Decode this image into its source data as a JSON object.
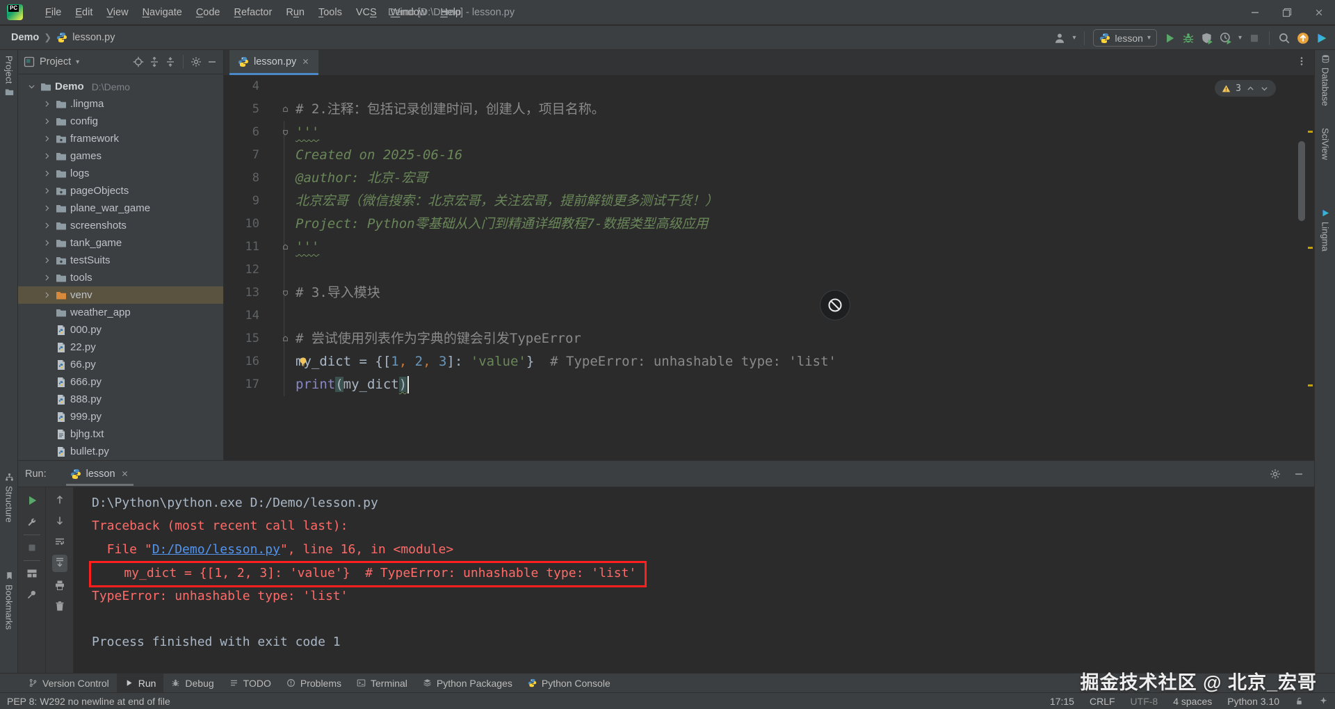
{
  "window": {
    "title": "Demo [D:\\Demo] - lesson.py"
  },
  "menu_items": [
    {
      "label": "File",
      "u": 0
    },
    {
      "label": "Edit",
      "u": 0
    },
    {
      "label": "View",
      "u": 0
    },
    {
      "label": "Navigate",
      "u": 0
    },
    {
      "label": "Code",
      "u": 0
    },
    {
      "label": "Refactor",
      "u": 0
    },
    {
      "label": "Run",
      "u": 1
    },
    {
      "label": "Tools",
      "u": 0
    },
    {
      "label": "VCS",
      "u": 2
    },
    {
      "label": "Window",
      "u": 0
    },
    {
      "label": "Help",
      "u": 0
    }
  ],
  "breadcrumbs": {
    "project": "Demo",
    "file": "lesson.py"
  },
  "navbar_right": {
    "run_config": "lesson"
  },
  "project_panel": {
    "title": "Project"
  },
  "project_tree": [
    {
      "label": "Demo",
      "path": "D:\\Demo",
      "icon": "folder",
      "chevron": "down",
      "bold": true,
      "root": true
    },
    {
      "label": ".lingma",
      "icon": "folder",
      "chevron": "right"
    },
    {
      "label": "config",
      "icon": "folder",
      "chevron": "right"
    },
    {
      "label": "framework",
      "icon": "folder-package",
      "chevron": "right"
    },
    {
      "label": "games",
      "icon": "folder",
      "chevron": "right"
    },
    {
      "label": "logs",
      "icon": "folder",
      "chevron": "right"
    },
    {
      "label": "pageObjects",
      "icon": "folder-package",
      "chevron": "right"
    },
    {
      "label": "plane_war_game",
      "icon": "folder",
      "chevron": "right"
    },
    {
      "label": "screenshots",
      "icon": "folder",
      "chevron": "right"
    },
    {
      "label": "tank_game",
      "icon": "folder",
      "chevron": "right"
    },
    {
      "label": "testSuits",
      "icon": "folder-package",
      "chevron": "right"
    },
    {
      "label": "tools",
      "icon": "folder",
      "chevron": "right"
    },
    {
      "label": "venv",
      "icon": "folder-excluded",
      "chevron": "right",
      "selected": true
    },
    {
      "label": "weather_app",
      "icon": "folder",
      "chevron": "none"
    },
    {
      "label": "000.py",
      "icon": "file-python",
      "chevron": "none"
    },
    {
      "label": "22.py",
      "icon": "file-python",
      "chevron": "none"
    },
    {
      "label": "66.py",
      "icon": "file-python",
      "chevron": "none"
    },
    {
      "label": "666.py",
      "icon": "file-python",
      "chevron": "none"
    },
    {
      "label": "888.py",
      "icon": "file-python",
      "chevron": "none"
    },
    {
      "label": "999.py",
      "icon": "file-python",
      "chevron": "none"
    },
    {
      "label": "bjhg.txt",
      "icon": "file-text",
      "chevron": "none"
    },
    {
      "label": "bullet.py",
      "icon": "file-python",
      "chevron": "none"
    }
  ],
  "editor": {
    "tab": "lesson.py",
    "warning_count": "3",
    "lines": [
      {
        "n": 4,
        "seg": []
      },
      {
        "n": 5,
        "fold": "up",
        "seg": [
          {
            "t": "# 2.注释：包括记录创建时间，创建人，项目名称。",
            "c": "cmt"
          }
        ]
      },
      {
        "n": 6,
        "fold": "down",
        "seg": [
          {
            "t": "'''",
            "c": "str wavy"
          }
        ]
      },
      {
        "n": 7,
        "seg": [
          {
            "t": "Created on 2025-06-16",
            "c": "doc"
          }
        ]
      },
      {
        "n": 8,
        "seg": [
          {
            "t": "@author: 北京-宏哥",
            "c": "doc"
          }
        ]
      },
      {
        "n": 9,
        "seg": [
          {
            "t": "北京宏哥（微信搜索：北京宏哥，关注宏哥，提前解锁更多测试干货！）",
            "c": "doc"
          }
        ]
      },
      {
        "n": 10,
        "seg": [
          {
            "t": "Project: Python零基础从入门到精通详细教程7-数据类型高级应用",
            "c": "doc"
          }
        ]
      },
      {
        "n": 11,
        "fold": "up",
        "seg": [
          {
            "t": "'''",
            "c": "str wavy"
          }
        ]
      },
      {
        "n": 12,
        "seg": []
      },
      {
        "n": 13,
        "fold": "down",
        "seg": [
          {
            "t": "# 3.导入模块",
            "c": "cmt"
          }
        ]
      },
      {
        "n": 14,
        "seg": []
      },
      {
        "n": 15,
        "fold": "up",
        "seg": [
          {
            "t": "# 尝试使用列表作为字典的键会引发TypeError",
            "c": "cmt"
          }
        ]
      },
      {
        "n": 16,
        "bulb": true,
        "seg": [
          {
            "t": "my_dict = {[",
            "c": "pln"
          },
          {
            "t": "1",
            "c": "num"
          },
          {
            "t": ", ",
            "c": "op"
          },
          {
            "t": "2",
            "c": "num"
          },
          {
            "t": ", ",
            "c": "op"
          },
          {
            "t": "3",
            "c": "num"
          },
          {
            "t": "]: ",
            "c": "pln"
          },
          {
            "t": "'value'",
            "c": "str"
          },
          {
            "t": "}  ",
            "c": "pln"
          },
          {
            "t": "# TypeError: unhashable type: 'list'",
            "c": "cmt"
          }
        ]
      },
      {
        "n": 17,
        "cursor": true,
        "seg": [
          {
            "t": "print",
            "c": "fn"
          },
          {
            "t": "(",
            "c": "pln hl"
          },
          {
            "t": "my_dict",
            "c": "pln"
          },
          {
            "t": ")",
            "c": "pln hl wavy"
          }
        ]
      }
    ]
  },
  "run_panel": {
    "label": "Run:",
    "tab": "lesson",
    "console": [
      {
        "seg": [
          {
            "t": "D:\\Python\\python.exe D:/Demo/lesson.py",
            "c": "pln"
          }
        ]
      },
      {
        "seg": [
          {
            "t": "Traceback (most recent call last):",
            "c": "err"
          }
        ]
      },
      {
        "seg": [
          {
            "t": "  File \"",
            "c": "err"
          },
          {
            "t": "D:/Demo/lesson.py",
            "c": "lnk"
          },
          {
            "t": "\", line 16, in <module>",
            "c": "err"
          }
        ]
      },
      {
        "boxed": true,
        "seg": [
          {
            "t": "    my_dict = {[1, 2, 3]: 'value'}  # TypeError: unhashable type: 'list'",
            "c": "err"
          }
        ]
      },
      {
        "seg": [
          {
            "t": "TypeError: unhashable type: 'list'",
            "c": "err"
          }
        ]
      },
      {
        "seg": []
      },
      {
        "seg": [
          {
            "t": "Process finished with exit code 1",
            "c": "pln"
          }
        ]
      }
    ]
  },
  "bottom_bar": [
    {
      "icon": "branch",
      "label": "Version Control"
    },
    {
      "icon": "play-small",
      "label": "Run",
      "active": true
    },
    {
      "icon": "bug-small",
      "label": "Debug"
    },
    {
      "icon": "todo",
      "label": "TODO"
    },
    {
      "icon": "problems",
      "label": "Problems"
    },
    {
      "icon": "terminal",
      "label": "Terminal"
    },
    {
      "icon": "packages",
      "label": "Python Packages"
    },
    {
      "icon": "python",
      "label": "Python Console"
    }
  ],
  "status_bar": {
    "left": "PEP 8: W292 no newline at end of file",
    "right": [
      "17:15",
      "CRLF",
      "UTF-8",
      "4 spaces",
      "Python 3.10"
    ]
  },
  "left_stripe": [
    "Project",
    "Structure",
    "Bookmarks"
  ],
  "right_stripe": [
    "Database",
    "SciView",
    "Lingma"
  ],
  "watermark": "掘金技术社区 @ 北京_宏哥",
  "colors": {
    "accent_blue": "#4A88C7",
    "error_red": "#FF6B68",
    "link_blue": "#5394EC",
    "selection_olive": "#5A5340",
    "warning_yellow": "#F2C55C",
    "run_green": "#59A869"
  }
}
